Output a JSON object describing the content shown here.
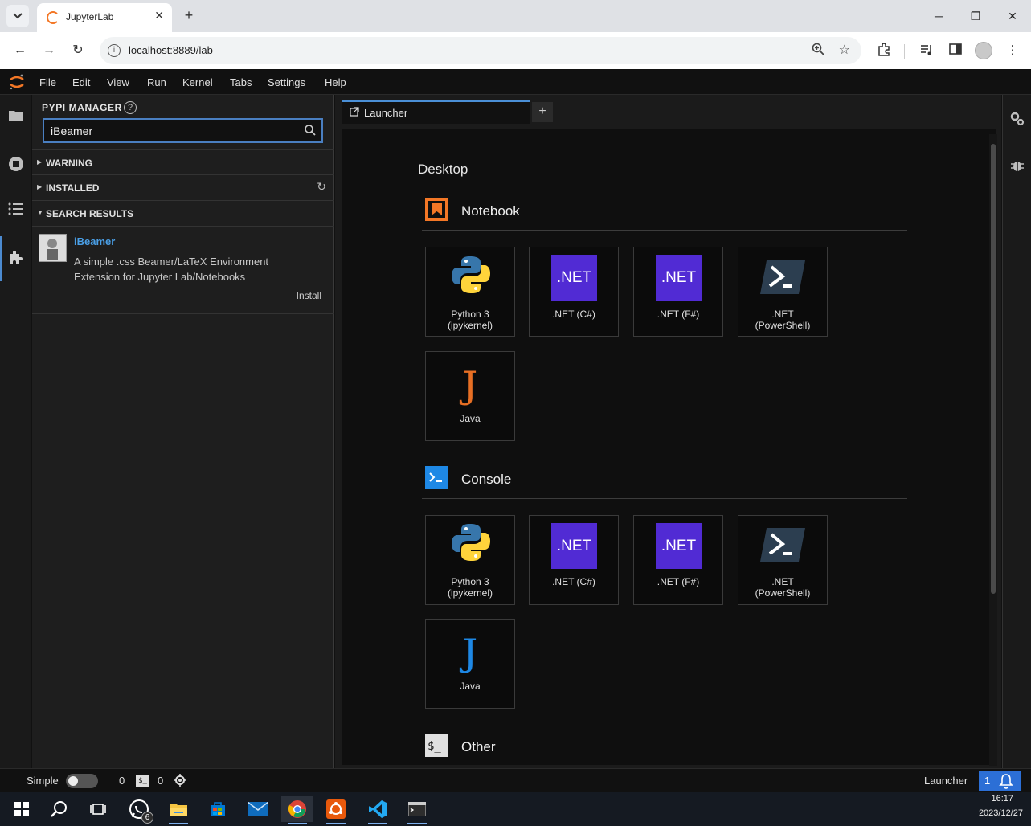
{
  "browser": {
    "tab_title": "JupyterLab",
    "url": "localhost:8889/lab"
  },
  "menubar": {
    "items": [
      "File",
      "Edit",
      "View",
      "Run",
      "Kernel",
      "Tabs",
      "Settings",
      "Help"
    ]
  },
  "sidepanel": {
    "title": "PYPI MANAGER",
    "search_value": "iBeamer",
    "sections": {
      "warning": "WARNING",
      "installed": "INSTALLED",
      "search_results": "SEARCH RESULTS"
    },
    "result": {
      "name": "iBeamer",
      "description": "A simple .css Beamer/LaTeX Environment Extension for Jupyter Lab/Notebooks",
      "action": "Install"
    }
  },
  "dock": {
    "tab_label": "Launcher"
  },
  "launcher": {
    "heading": "Desktop",
    "notebook": {
      "title": "Notebook",
      "cards": [
        {
          "line1": "Python 3",
          "line2": "(ipykernel)"
        },
        {
          "line1": ".NET (C#)",
          "line2": ""
        },
        {
          "line1": ".NET (F#)",
          "line2": ""
        },
        {
          "line1": ".NET",
          "line2": "(PowerShell)"
        },
        {
          "line1": "Java",
          "line2": ""
        }
      ]
    },
    "console": {
      "title": "Console",
      "cards": [
        {
          "line1": "Python 3",
          "line2": "(ipykernel)"
        },
        {
          "line1": ".NET (C#)",
          "line2": ""
        },
        {
          "line1": ".NET (F#)",
          "line2": ""
        },
        {
          "line1": ".NET",
          "line2": "(PowerShell)"
        },
        {
          "line1": "Java",
          "line2": ""
        }
      ]
    },
    "other": {
      "title": "Other"
    },
    "net_logo_text": ".NET",
    "java_logo_text": "J"
  },
  "statusbar": {
    "mode_label": "Simple",
    "kernels_count": "0",
    "terminals_count": "0",
    "current_tab": "Launcher",
    "notifications_count": "1"
  },
  "taskbar": {
    "whatsapp_badge": "6",
    "time": "16:17",
    "date": "2023/12/27"
  },
  "colors": {
    "jupyter_orange": "#f37726",
    "dotnet_purple": "#512bd4",
    "accent_blue": "#2c6fd6",
    "result_link": "#4a9fe6"
  }
}
